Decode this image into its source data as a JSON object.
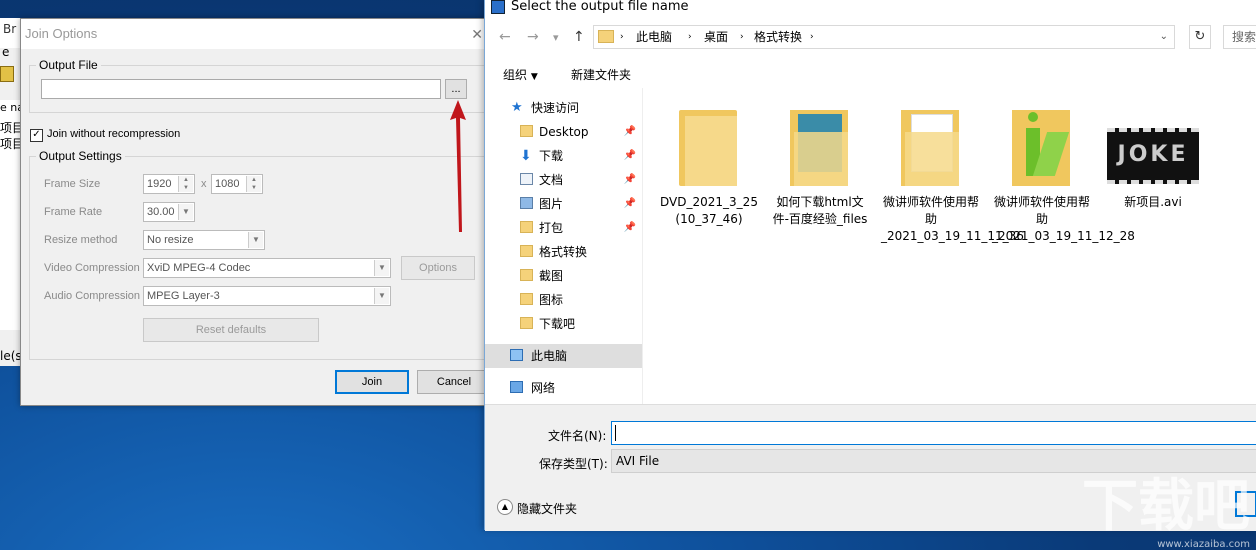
{
  "bg_app": {
    "title_fragment": "Br",
    "menu_fragment": "e",
    "header_fragment": "e na",
    "row1": "项目",
    "row2": "项目",
    "status_fragment": "le(s"
  },
  "join_dialog": {
    "title": "Join Options",
    "output_file_group": "Output File",
    "output_file_value": "",
    "browse_label": "...",
    "join_without_recompression": "Join without recompression",
    "output_settings_group": "Output Settings",
    "frame_size_label": "Frame Size",
    "frame_width": "1920",
    "frame_x": "x",
    "frame_height": "1080",
    "frame_rate_label": "Frame Rate",
    "frame_rate": "30.00",
    "resize_label": "Resize method",
    "resize_value": "No resize",
    "video_comp_label": "Video Compression",
    "video_comp_value": "XviD MPEG-4 Codec",
    "options_label": "Options",
    "audio_comp_label": "Audio Compression",
    "audio_comp_value": "MPEG Layer-3",
    "reset_label": "Reset defaults",
    "join_label": "Join",
    "cancel_label": "Cancel"
  },
  "file_dialog": {
    "title": "Select the output file name",
    "breadcrumbs": [
      "此电脑",
      "桌面",
      "格式转换"
    ],
    "organize": "组织",
    "new_folder": "新建文件夹",
    "search_placeholder": "搜索",
    "nav": {
      "quick_access": "快速访问",
      "desktop": "Desktop",
      "downloads": "下载",
      "documents": "文档",
      "pictures": "图片",
      "pack": "打包",
      "format_convert": "格式转换",
      "screenshot": "截图",
      "icons": "图标",
      "download_bar": "下载吧",
      "this_pc": "此电脑",
      "network": "网络"
    },
    "items": [
      {
        "name": "DVD_2021_3_25 (10_37_46)"
      },
      {
        "name": "如何下载html文件-百度经验_files"
      },
      {
        "name": "微讲师软件使用帮助_2021_03_19_11_11_36"
      },
      {
        "name": "微讲师软件使用帮助_2021_03_19_11_12_28"
      },
      {
        "name": "新项目.avi"
      }
    ],
    "thumb_text": "JOKE",
    "filename_label": "文件名(N):",
    "filename_value": "",
    "filetype_label": "保存类型(T):",
    "filetype_value": "AVI File",
    "hide_folders": "隐藏文件夹"
  },
  "watermark": {
    "text": "下载吧",
    "url": "www.xiazaiba.com"
  },
  "colors": {
    "accent": "#0078d7",
    "folder": "#f5d27a",
    "arrow": "#c0161b"
  }
}
